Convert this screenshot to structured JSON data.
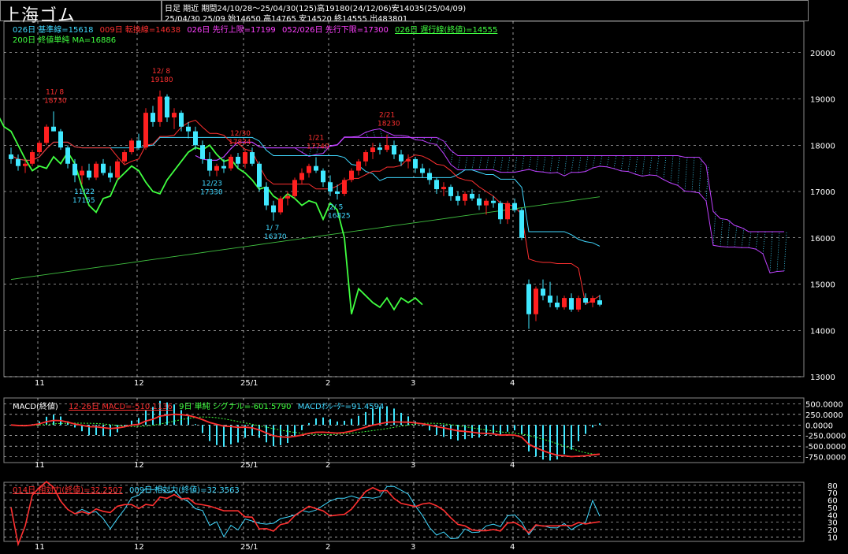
{
  "header": {
    "title": "上海ゴム",
    "line1": "日足  期近  期間24/10/28～25/04/30(125)高19180(24/12/06)安14035(25/04/09)",
    "line2": "25/04/30 25/09 始14650 高14765 安14520 終14555 出483801"
  },
  "main_legend": [
    {
      "text": "026日 基準線=15618",
      "color": "#40d8ff"
    },
    {
      "text": "009日 転換線=14638",
      "color": "#ff3030"
    },
    {
      "text": "026日 先行上限=17199",
      "color": "#ff40ff"
    },
    {
      "text": "052/026日 先行下限=17300",
      "color": "#ff40ff"
    },
    {
      "text": "026日 遅行線(終値)=14555",
      "color": "#40ff40"
    },
    {
      "text": "200日 終値単純 MA=16886",
      "color": "#40ff40"
    }
  ],
  "macd_legend": [
    {
      "text": "MACD(終値)",
      "color": "#ffffff"
    },
    {
      "text": "12-26日 MACD=-510.1136",
      "color": "#ff3030"
    },
    {
      "text": "9日 単純 シグナル=-601.5790",
      "color": "#40ff40"
    },
    {
      "text": "MACDｵｼﾚｰﾀｰ=91.4594",
      "color": "#40d8ff"
    }
  ],
  "rsi_legend": [
    {
      "text": "014日 相対力(終値)=32.2507",
      "color": "#ff3030"
    },
    {
      "text": "009日 相対力(終値)=32.3563",
      "color": "#40d8ff"
    }
  ],
  "colors": {
    "up": "#ff2020",
    "down": "#40e8ff",
    "kumo": "#c040ff",
    "chikou": "#40ff40",
    "ma": "#40c040",
    "base": "#40d8ff",
    "conv": "#ff3030"
  },
  "chart_data": [
    {
      "type": "candlestick",
      "x_ticks": [
        "11",
        "12",
        "25/1",
        "2",
        "3",
        "4"
      ],
      "y_ticks": [
        "20000",
        "19000",
        "18000",
        "17000",
        "16000",
        "15000",
        "14000",
        "13000"
      ],
      "ylim": [
        13000,
        20200
      ],
      "annotations": [
        {
          "date": "11/ 8",
          "value": "18730",
          "kind": "high"
        },
        {
          "date": "12/ 8",
          "value": "19180",
          "kind": "high"
        },
        {
          "date": "12/30",
          "value": "17834",
          "kind": "high"
        },
        {
          "date": "1/21",
          "value": "17740",
          "kind": "high"
        },
        {
          "date": "2/21",
          "value": "18230",
          "kind": "high"
        },
        {
          "date": "11/22",
          "value": "17155",
          "kind": "low"
        },
        {
          "date": "12/23",
          "value": "17330",
          "kind": "low"
        },
        {
          "date": "1/ 7",
          "value": "16370",
          "kind": "low"
        },
        {
          "date": "2/ 5",
          "value": "16825",
          "kind": "low"
        }
      ],
      "candles": [
        [
          17800,
          17950,
          17600,
          17700
        ],
        [
          17700,
          17800,
          17450,
          17550
        ],
        [
          17550,
          17700,
          17400,
          17600
        ],
        [
          17600,
          17900,
          17550,
          17850
        ],
        [
          17850,
          18100,
          17800,
          18050
        ],
        [
          18050,
          18450,
          18000,
          18400
        ],
        [
          18400,
          18730,
          18300,
          18300
        ],
        [
          18300,
          18350,
          17900,
          17950
        ],
        [
          17950,
          18000,
          17500,
          17600
        ],
        [
          17600,
          17700,
          17200,
          17350
        ],
        [
          17350,
          17550,
          17155,
          17450
        ],
        [
          17450,
          17600,
          17250,
          17300
        ],
        [
          17300,
          17650,
          17250,
          17600
        ],
        [
          17600,
          17700,
          17350,
          17400
        ],
        [
          17400,
          17550,
          17200,
          17300
        ],
        [
          17300,
          17700,
          17250,
          17650
        ],
        [
          17650,
          17900,
          17600,
          17850
        ],
        [
          17850,
          18150,
          17800,
          18100
        ],
        [
          18100,
          18250,
          17900,
          17950
        ],
        [
          17950,
          18800,
          17900,
          18700
        ],
        [
          18700,
          18850,
          18400,
          18500
        ],
        [
          18500,
          19180,
          18400,
          19050
        ],
        [
          19050,
          19100,
          18500,
          18600
        ],
        [
          18600,
          18800,
          18350,
          18700
        ],
        [
          18700,
          18750,
          18300,
          18400
        ],
        [
          18400,
          18500,
          18150,
          18300
        ],
        [
          18300,
          18400,
          17900,
          18000
        ],
        [
          18000,
          18100,
          17600,
          17700
        ],
        [
          17700,
          17850,
          17330,
          17450
        ],
        [
          17450,
          17600,
          17330,
          17550
        ],
        [
          17550,
          17700,
          17400,
          17500
        ],
        [
          17500,
          17800,
          17450,
          17750
        ],
        [
          17750,
          17834,
          17500,
          17600
        ],
        [
          17600,
          17900,
          17500,
          17850
        ],
        [
          17850,
          17950,
          17550,
          17600
        ],
        [
          17600,
          17650,
          17000,
          17100
        ],
        [
          17100,
          17200,
          16600,
          16700
        ],
        [
          16700,
          16800,
          16370,
          16550
        ],
        [
          16550,
          16900,
          16500,
          16850
        ],
        [
          16850,
          17000,
          16700,
          16900
        ],
        [
          16900,
          17300,
          16850,
          17250
        ],
        [
          17250,
          17500,
          17150,
          17400
        ],
        [
          17400,
          17600,
          17300,
          17550
        ],
        [
          17550,
          17740,
          17400,
          17450
        ],
        [
          17450,
          17500,
          17100,
          17200
        ],
        [
          17200,
          17350,
          16900,
          17000
        ],
        [
          17000,
          17150,
          16825,
          16950
        ],
        [
          16950,
          17300,
          16900,
          17250
        ],
        [
          17250,
          17500,
          17200,
          17450
        ],
        [
          17450,
          17700,
          17350,
          17650
        ],
        [
          17650,
          17900,
          17550,
          17850
        ],
        [
          17850,
          18050,
          17700,
          17950
        ],
        [
          17950,
          18050,
          17800,
          17900
        ],
        [
          17900,
          18230,
          17850,
          18000
        ],
        [
          18000,
          18100,
          17700,
          17800
        ],
        [
          17800,
          17900,
          17550,
          17650
        ],
        [
          17650,
          17800,
          17500,
          17700
        ],
        [
          17700,
          17750,
          17400,
          17500
        ],
        [
          17500,
          17600,
          17300,
          17400
        ],
        [
          17400,
          17500,
          17150,
          17250
        ],
        [
          17250,
          17300,
          16950,
          17050
        ],
        [
          17050,
          17200,
          16900,
          17100
        ],
        [
          17100,
          17150,
          16800,
          16900
        ],
        [
          16900,
          17000,
          16700,
          16800
        ],
        [
          16800,
          17000,
          16700,
          16950
        ],
        [
          16950,
          17050,
          16800,
          16850
        ],
        [
          16850,
          16950,
          16600,
          16700
        ],
        [
          16700,
          16850,
          16500,
          16800
        ],
        [
          16800,
          16900,
          16650,
          16750
        ],
        [
          16750,
          16800,
          16300,
          16400
        ],
        [
          16400,
          16800,
          16300,
          16750
        ],
        [
          16750,
          16850,
          16550,
          16600
        ],
        [
          16600,
          16650,
          15950,
          16000
        ],
        [
          15000,
          15100,
          14035,
          14350
        ],
        [
          14350,
          14950,
          14200,
          14900
        ],
        [
          14900,
          15100,
          14650,
          14750
        ],
        [
          14750,
          15050,
          14500,
          14600
        ],
        [
          14600,
          14750,
          14450,
          14500
        ],
        [
          14500,
          14750,
          14450,
          14700
        ],
        [
          14700,
          14800,
          14400,
          14450
        ],
        [
          14450,
          14750,
          14400,
          14700
        ],
        [
          14700,
          14800,
          14550,
          14600
        ],
        [
          14600,
          14750,
          14500,
          14700
        ],
        [
          14650,
          14765,
          14520,
          14555
        ]
      ]
    },
    {
      "type": "macd",
      "y_ticks": [
        "500.0000",
        "250.0000",
        "0.0000",
        "-250.0000",
        "-500.0000",
        "-750.0000"
      ],
      "ylim": [
        -850,
        600
      ]
    },
    {
      "type": "rsi",
      "y_ticks": [
        "80",
        "70",
        "60",
        "50",
        "40",
        "30",
        "20",
        "10"
      ],
      "ylim": [
        5,
        82
      ]
    }
  ]
}
